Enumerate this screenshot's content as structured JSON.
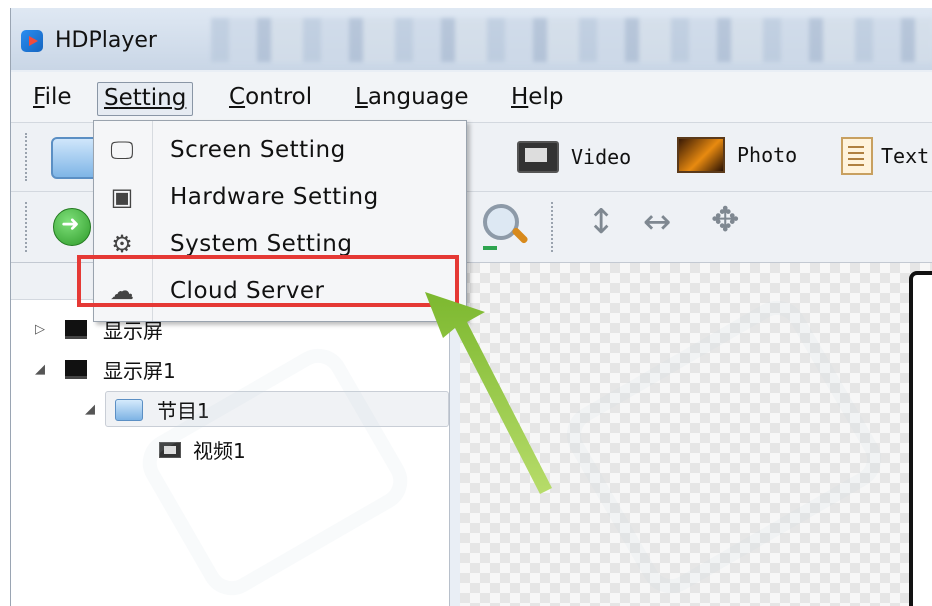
{
  "window": {
    "title": "HDPlayer"
  },
  "menubar": {
    "items": [
      {
        "label": "File",
        "access": "F",
        "rest": "ile"
      },
      {
        "label": "Setting",
        "access": "S",
        "rest": "etting"
      },
      {
        "label": "Control",
        "access": "C",
        "rest": "ontrol"
      },
      {
        "label": "Language",
        "access": "L",
        "rest": "anguage"
      },
      {
        "label": "Help",
        "access": "H",
        "rest": "elp"
      }
    ]
  },
  "toolbar": {
    "video_label": "Video",
    "photo_label": "Photo",
    "text_label": "Text"
  },
  "setting_menu": {
    "items": [
      {
        "label": "Screen Setting",
        "icon": "monitor-icon"
      },
      {
        "label": "Hardware Setting",
        "icon": "chip-icon"
      },
      {
        "label": "System Setting",
        "icon": "gear-icon"
      },
      {
        "label": "Cloud Server",
        "icon": "cloud-icon",
        "highlighted": true
      }
    ]
  },
  "tree": {
    "items": [
      {
        "label": "显示屏",
        "expanded": false
      },
      {
        "label": "显示屏1",
        "expanded": true
      },
      {
        "label": "节目1",
        "expanded": true,
        "selected": true
      },
      {
        "label": "视频1"
      }
    ]
  },
  "colors": {
    "highlight_box": "#e53935",
    "pointer_arrow": "#8bc34a"
  }
}
